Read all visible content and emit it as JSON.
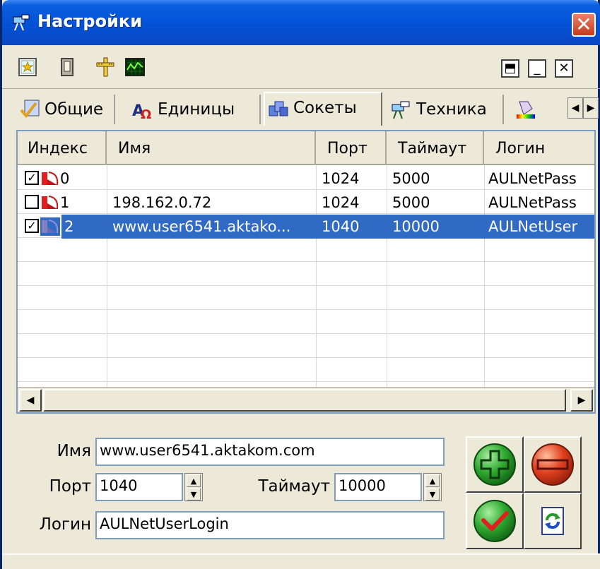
{
  "window": {
    "title": "Настройки",
    "close_glyph": "✕"
  },
  "toolbar": {
    "icons": [
      "star-document-icon",
      "book-icon",
      "ruler-icon",
      "oscilloscope-icon"
    ],
    "window_controls": [
      "restore-icon",
      "minimize-icon",
      "close-icon"
    ],
    "restore_glyph": "⬒",
    "minimize_glyph": "_",
    "close_glyph": "✕"
  },
  "tabs": [
    {
      "label": "Общие",
      "icon": "settings-check-icon",
      "active": false
    },
    {
      "label": "Единицы",
      "icon": "units-omega-icon",
      "active": false
    },
    {
      "label": "Сокеты",
      "icon": "sockets-icon",
      "active": true
    },
    {
      "label": "Техника",
      "icon": "equipment-icon",
      "active": false
    },
    {
      "label": "",
      "icon": "paint-icon",
      "active": false
    }
  ],
  "tab_scroll": {
    "left": "◀",
    "right": "▶"
  },
  "table": {
    "columns": [
      "Индекс",
      "Имя",
      "Порт",
      "Таймаут",
      "Логин"
    ],
    "rows": [
      {
        "checked": true,
        "index": "0",
        "name": "",
        "port": "1024",
        "timeout": "5000",
        "login": "AULNetPass",
        "selected": false
      },
      {
        "checked": false,
        "index": "1",
        "name": "198.162.0.72",
        "port": "1024",
        "timeout": "5000",
        "login": "AULNetPass",
        "selected": false
      },
      {
        "checked": true,
        "index": "2",
        "name": "www.user6541.aktako...",
        "port": "1040",
        "timeout": "10000",
        "login": "AULNetUser",
        "selected": true
      }
    ],
    "check_mark": "✓",
    "scroll_left": "◀",
    "scroll_right": "▶"
  },
  "form": {
    "name_label": "Имя",
    "name_value": "www.user6541.aktakom.com",
    "port_label": "Порт",
    "port_value": "1040",
    "timeout_label": "Таймаут",
    "timeout_value": "10000",
    "login_label": "Логин",
    "login_value": "AULNetUserLogin",
    "spin_up": "▲",
    "spin_down": "▼"
  },
  "actions": [
    "add-icon",
    "remove-icon",
    "apply-icon",
    "refresh-icon"
  ],
  "colors": {
    "titlebar": "#0451d6",
    "selection": "#316ac5",
    "face": "#ece9d8",
    "add_green": "#2fa82f",
    "remove_red": "#e04020"
  }
}
